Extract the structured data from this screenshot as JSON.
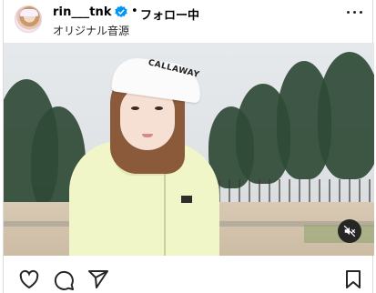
{
  "header": {
    "username": "rin___tnk",
    "separator": "•",
    "follow_label": "フォロー中",
    "audio_label": "オリジナル音源"
  },
  "media": {
    "visor_text": "CALLAWAY",
    "muted": true
  },
  "colors": {
    "verified": "#0095f6",
    "text": "#000000",
    "border": "#dbdbdb"
  },
  "icons": [
    "verified-badge-icon",
    "more-options-icon",
    "mute-icon",
    "heart-icon",
    "comment-icon",
    "share-icon",
    "bookmark-icon"
  ]
}
